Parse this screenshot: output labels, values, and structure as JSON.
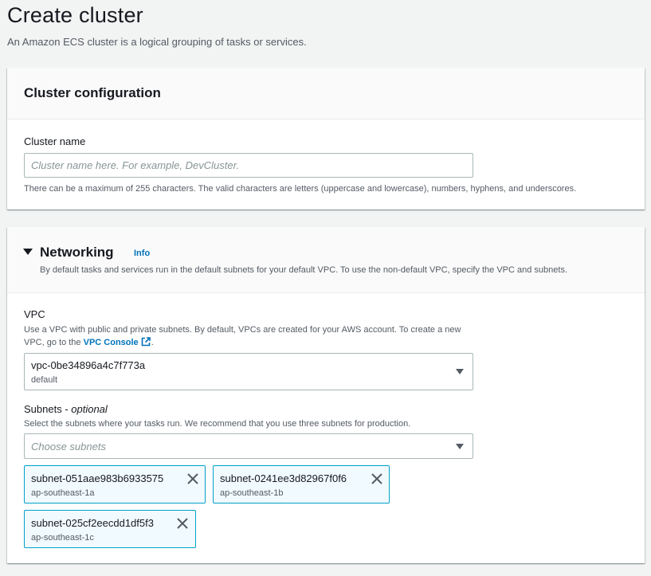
{
  "page": {
    "title": "Create cluster",
    "description": "An Amazon ECS cluster is a logical grouping of tasks or services."
  },
  "cluster_config": {
    "header": "Cluster configuration",
    "name_label": "Cluster name",
    "name_value": "",
    "name_placeholder": "Cluster name here. For example, DevCluster.",
    "name_hint": "There can be a maximum of 255 characters. The valid characters are letters (uppercase and lowercase), numbers, hyphens, and underscores."
  },
  "networking": {
    "header": "Networking",
    "info": "Info",
    "description": "By default tasks and services run in the default subnets for your default VPC. To use the non-default VPC, specify the VPC and subnets.",
    "vpc_label": "VPC",
    "vpc_desc_text": "Use a VPC with public and private subnets. By default, VPCs are created for your AWS account. To create a new VPC, go to the",
    "vpc_link": "VPC Console",
    "vpc_desc_end": ".",
    "vpc_value": "vpc-0be34896a4c7f773a",
    "vpc_sub": "default",
    "subnets_label": "Subnets",
    "subnets_optional": "optional",
    "subnets_label_sep": " - ",
    "subnets_desc": "Select the subnets where your tasks run. We recommend that you use three subnets for production.",
    "subnets_placeholder": "Choose subnets",
    "selected_subnets": [
      {
        "id": "subnet-051aae983b6933575",
        "az": "ap-southeast-1a"
      },
      {
        "id": "subnet-0241ee3d82967f0f6",
        "az": "ap-southeast-1b"
      },
      {
        "id": "subnet-025cf2eecdd1df5f3",
        "az": "ap-southeast-1c"
      }
    ]
  },
  "colors": {
    "link": "#0073bb",
    "token_bg": "#f1faff",
    "token_border": "#00a1c9",
    "page_bg": "#f2f3f3"
  },
  "icons": [
    "caret-down-icon",
    "external-link-icon",
    "dropdown-caret-icon",
    "close-icon"
  ]
}
